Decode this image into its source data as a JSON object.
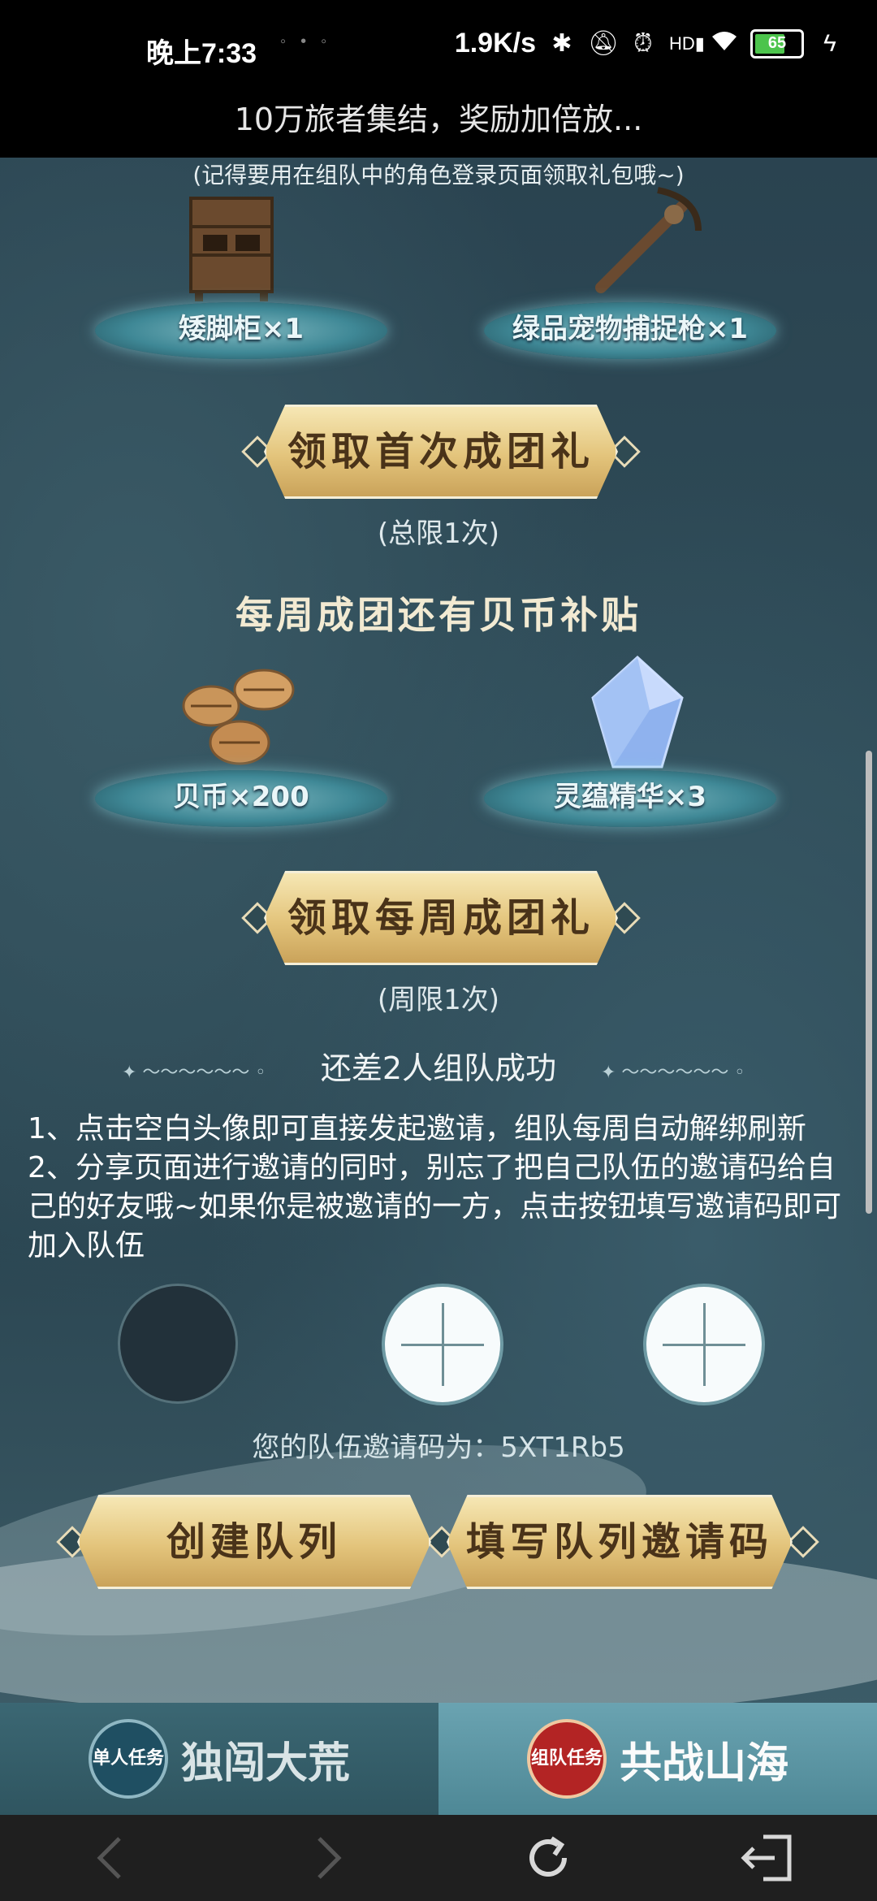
{
  "status_bar": {
    "time": "晚上7:33",
    "speed": "1.9K/s",
    "battery": "65"
  },
  "page_title": "10万旅者集结，奖励加倍放...",
  "note": "(记得要用在组队中的角色登录页面领取礼包哦~)",
  "first_gift": {
    "items": [
      {
        "label": "矮脚柜×1",
        "icon": "cabinet-icon"
      },
      {
        "label": "绿品宠物捕捉枪×1",
        "icon": "crossbow-icon"
      }
    ],
    "button": "领取首次成团礼",
    "limit": "(总限1次)"
  },
  "weekly_gift": {
    "heading": "每周成团还有贝币补贴",
    "items": [
      {
        "label": "贝币×200",
        "icon": "shell-coin-icon"
      },
      {
        "label": "灵蕴精华×3",
        "icon": "crystal-icon"
      }
    ],
    "button": "领取每周成团礼",
    "limit": "(周限1次)"
  },
  "team": {
    "status": "还差2人组队成功",
    "rule1": "1、点击空白头像即可直接发起邀请，组队每周自动解绑刷新",
    "rule2": "2、分享页面进行邀请的同时，别忘了把自己队伍的邀请码给自己的好友哦~如果你是被邀请的一方，点击按钮填写邀请码即可加入队伍",
    "invite_code_line": "您的队伍邀请码为：5XT1Rb5",
    "create_button": "创建队列",
    "fill_button": "填写队列邀请码"
  },
  "tabs": [
    {
      "badge": "单人任务",
      "label": "独闯大荒"
    },
    {
      "badge": "组队任务",
      "label": "共战山海"
    }
  ]
}
